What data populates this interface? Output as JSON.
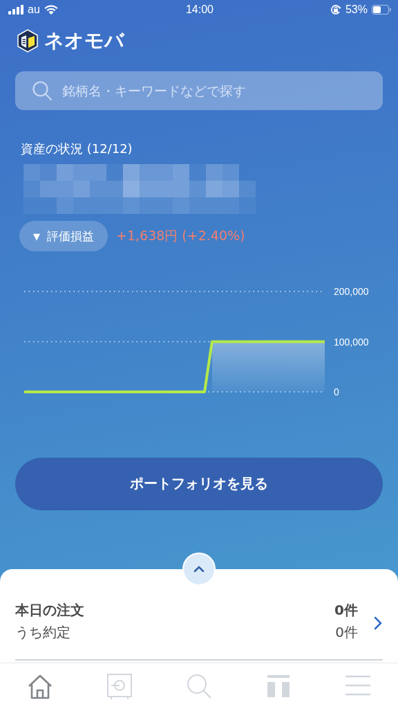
{
  "status_bar": {
    "carrier": "au",
    "time": "14:00",
    "battery": "53%"
  },
  "header": {
    "logo_text": "ネオモバ"
  },
  "search": {
    "placeholder": "銘柄名・キーワードなどで探す"
  },
  "assets": {
    "title": "資産の状況 (12/12)",
    "toggle_icon": "▼",
    "toggle_label": "評価損益",
    "gain": "+1,638円 (+2.40%)",
    "chart_data": {
      "type": "line",
      "ylim": [
        0,
        200000
      ],
      "yticks": [
        {
          "value": 0,
          "label": "0"
        },
        {
          "value": 100000,
          "label": "100,000"
        },
        {
          "value": 200000,
          "label": "200,000"
        }
      ],
      "series": [
        {
          "color": "#b5e84a",
          "values": [
            0,
            0,
            0,
            0,
            0,
            0,
            0,
            0,
            0,
            0,
            0,
            0,
            0,
            0,
            0,
            0,
            0,
            0,
            0,
            0,
            0,
            0,
            0,
            0,
            0,
            100000,
            100000,
            100000,
            100000,
            100000,
            100000,
            100000,
            100000,
            100000,
            100000,
            100000,
            100000,
            100000,
            100000,
            100000,
            100000
          ]
        }
      ]
    }
  },
  "portfolio_button": "ポートフォリオを見る",
  "orders": {
    "title": "本日の注文",
    "count": "0件",
    "sub_label": "うち約定",
    "sub_count": "0件"
  },
  "tab_bar": [
    {
      "kind": "home",
      "selected": true
    },
    {
      "kind": "safe",
      "selected": false
    },
    {
      "kind": "search",
      "selected": false
    },
    {
      "kind": "block",
      "selected": false
    },
    {
      "kind": "menu",
      "selected": false
    }
  ]
}
